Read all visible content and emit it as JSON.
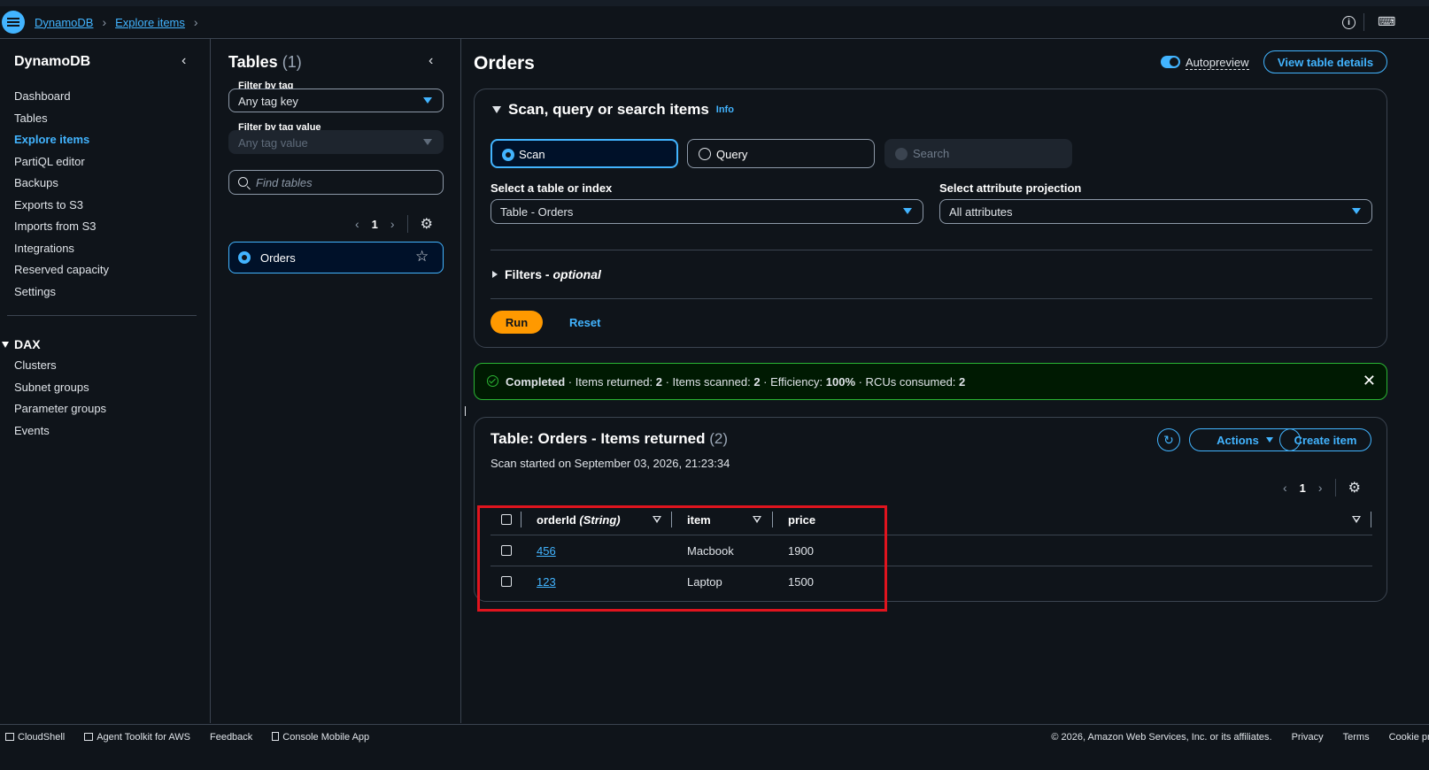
{
  "breadcrumbs": [
    "DynamoDB",
    "Explore items"
  ],
  "sidebar": {
    "title": "DynamoDB",
    "items": [
      "Dashboard",
      "Tables",
      "Explore items",
      "PartiQL editor",
      "Backups",
      "Exports to S3",
      "Imports from S3",
      "Integrations",
      "Reserved capacity",
      "Settings"
    ],
    "active_index": 2,
    "dax_title": "DAX",
    "dax_items": [
      "Clusters",
      "Subnet groups",
      "Parameter groups",
      "Events"
    ]
  },
  "tables_panel": {
    "title": "Tables",
    "count": "(1)",
    "filter_tag_label": "Filter by tag",
    "filter_tag_value": "Any tag key",
    "filter_value_label": "Filter by tag value",
    "filter_value_placeholder": "Any tag value",
    "search_placeholder": "Find tables",
    "page": "1",
    "table_name": "Orders"
  },
  "main": {
    "title": "Orders",
    "autopreview_label": "Autopreview",
    "view_details_label": "View table details",
    "scan_panel": {
      "heading": "Scan, query or search items",
      "info": "Info",
      "modes": [
        "Scan",
        "Query",
        "Search"
      ],
      "selected_mode": "Scan",
      "table_index_label": "Select a table or index",
      "table_index_value": "Table - Orders",
      "projection_label": "Select attribute projection",
      "projection_value": "All attributes",
      "filters_label": "Filters - ",
      "filters_optional": "optional",
      "run_label": "Run",
      "reset_label": "Reset"
    },
    "alert": {
      "status": "Completed",
      "items_returned_label": " · Items returned: ",
      "items_returned": "2",
      "items_scanned_label": " · Items scanned: ",
      "items_scanned": "2",
      "efficiency_label": " · Efficiency: ",
      "efficiency": "100%",
      "rcus_label": " · RCUs consumed: ",
      "rcus": "2"
    },
    "results": {
      "title": "Table: Orders - Items returned",
      "count": "(2)",
      "subtitle": "Scan started on September 03, 2026, 21:23:34",
      "actions_label": "Actions",
      "create_label": "Create item",
      "page": "1",
      "columns": [
        "orderId",
        "(String)",
        "item",
        "price"
      ],
      "rows": [
        {
          "orderId": "456",
          "item": "Macbook",
          "price": "1900"
        },
        {
          "orderId": "123",
          "item": "Laptop",
          "price": "1500"
        }
      ]
    }
  },
  "footer": {
    "left": [
      "CloudShell",
      "Agent Toolkit for AWS",
      "Feedback",
      "Console Mobile App"
    ],
    "copyright": "© 2026, Amazon Web Services, Inc. or its affiliates.",
    "right": [
      "Privacy",
      "Terms",
      "Cookie preferences"
    ]
  },
  "colors": {
    "accent": "#42b4ff",
    "run": "#ff9900",
    "success": "#2bb534",
    "highlight_box": "#e0141e"
  }
}
